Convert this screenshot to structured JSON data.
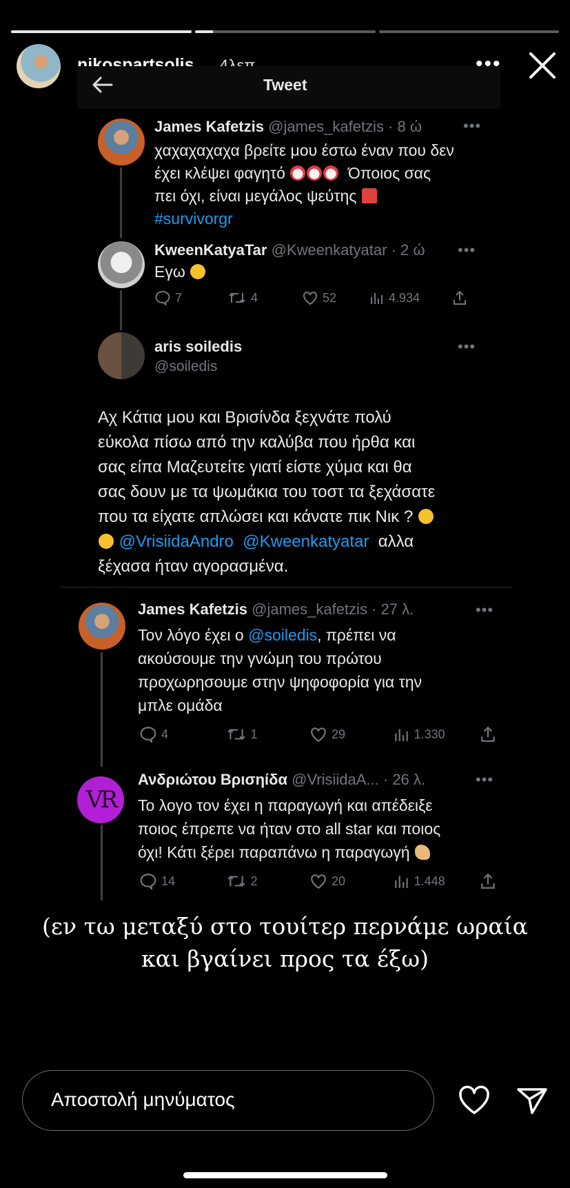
{
  "story": {
    "username": "nikospartsolis",
    "time_ago": "4λεπ.",
    "progress": [
      1.0,
      0.1,
      0.0
    ]
  },
  "tweet_header": {
    "title": "Tweet"
  },
  "tweets": [
    {
      "name": "James Kafetzis",
      "handle": "@james_kafetzis · 8 ώ",
      "text_1": "χαχαχαχαχα βρείτε μου έστω έναν που δεν",
      "text_2a": "έχει κλέψει φαγητό",
      "text_2b": "Όποιος σας",
      "text_3": "πει όχι, είναι μεγάλος ψεύτης",
      "hashtag": "#survivorgr"
    },
    {
      "name": "KweenKatyaTar",
      "handle": "@Kweenkatyatar · 2 ώ",
      "text": "Εγω",
      "replies": "7",
      "retweets": "4",
      "likes": "52",
      "views": "4.934"
    },
    {
      "name": "aris soiledis",
      "handle": "@soiledis",
      "lines": [
        "Αχ Κάτια μου και Βρισίνδα ξεχνάτε πολύ",
        "εύκολα πίσω από την καλύβα που ήρθα και",
        "σας είπα Μαζευτείτε γιατί είστε χύμα και θα",
        "σας δουν με τα ψωμάκια του τοστ  τα ξεχάσατε",
        "που τα είχατε απλώσει και κάνατε πικ Νικ ?"
      ],
      "mention_1": "@VrisiidaAndro",
      "mention_2": "@Kweenkatyatar",
      "after_mentions": "αλλα",
      "last_line": "ξέχασα ήταν αγορασμένα."
    },
    {
      "name": "James Kafetzis",
      "handle": "@james_kafetzis · 27 λ.",
      "text_1a": "Τον λόγο έχει ο",
      "mention": "@soiledis",
      "text_1b": ", πρέπει να",
      "text_2": "ακούσουμε την γνώμη του πρώτου",
      "text_3": "προχωρησουμε στην ψηφοφορία για την",
      "text_4": "μπλε ομάδα",
      "replies": "4",
      "retweets": "1",
      "likes": "29",
      "views": "1.330"
    },
    {
      "name": "Ανδριώτου Βρισηίδα",
      "handle": "@VrisiidaA... · 26 λ.",
      "avatar_text": "VR",
      "text_1": "Το λογο τον έχει η παραγωγή και απέδειξε",
      "text_2": "ποιος έπρεπε να ήταν στο all star και ποιος",
      "text_3": "όχι! Κάτι ξέρει παραπάνω η παραγωγή",
      "replies": "14",
      "retweets": "2",
      "likes": "20",
      "views": "1.448"
    }
  ],
  "caption": {
    "line_1": "(εν τω μεταξύ στο τουίτερ περνάμε ωραία",
    "line_2": "και βγαίνει προς τα έξω)"
  },
  "message_box": {
    "placeholder": "Αποστολή μηνύματος"
  },
  "colors": {
    "background": "#000000",
    "link": "#1d9bf0",
    "muted": "#71767b",
    "avatar_vr": "#b31fd6"
  }
}
